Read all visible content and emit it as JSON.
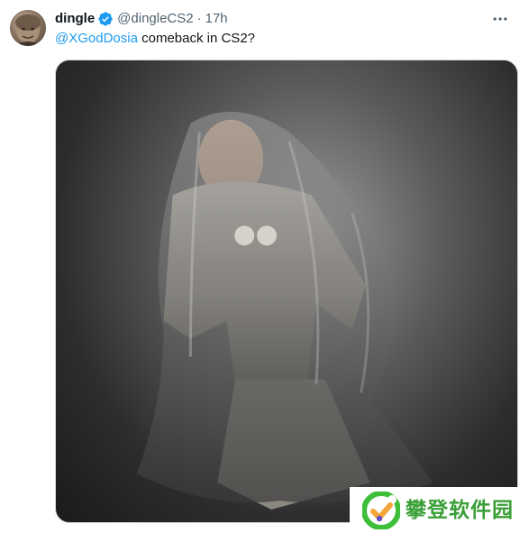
{
  "tweet": {
    "display_name": "dingle",
    "handle": "@dingleCS2",
    "separator": "·",
    "timestamp": "17h",
    "mention": "@XGodDosia",
    "text": " comeback in CS2?",
    "media": {
      "icon": "photo-person-under-sheer-veil"
    }
  },
  "watermark": {
    "text": "攀登软件园",
    "color": "#3a9f37"
  },
  "colors": {
    "accent": "#1d9bf0",
    "secondary_text": "#536471",
    "primary_text": "#0f1419"
  }
}
